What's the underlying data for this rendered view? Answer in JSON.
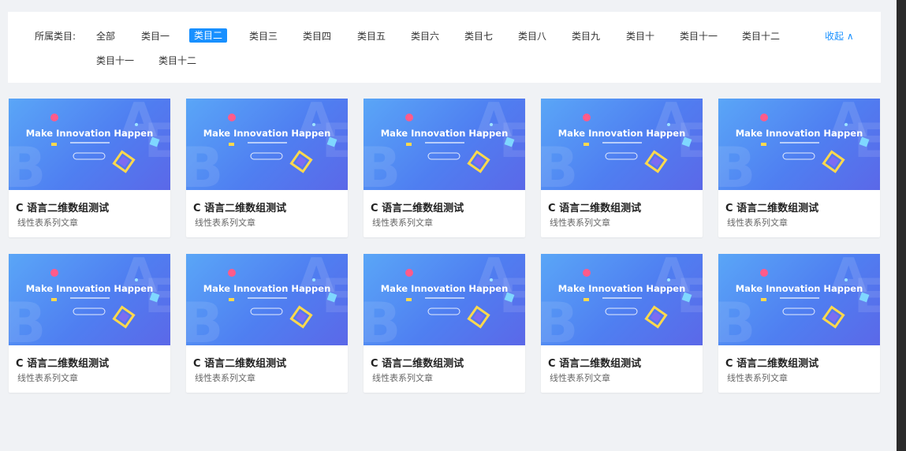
{
  "filter": {
    "label": "所属类目:",
    "categories": [
      "全部",
      "类目一",
      "类目二",
      "类目三",
      "类目四",
      "类目五",
      "类目六",
      "类目七",
      "类目八",
      "类目九",
      "类目十",
      "类目十一",
      "类目十二",
      "类目十一",
      "类目十二"
    ],
    "active_index": 2,
    "collapse_label": "收起 ∧"
  },
  "banner": {
    "headline": "Make Innovation Happen",
    "colors": {
      "from": "#5aa6f7",
      "to": "#5b68e8"
    }
  },
  "cards": [
    {
      "title": "C 语言二维数组测试",
      "subtitle": "线性表系列文章"
    },
    {
      "title": "C 语言二维数组测试",
      "subtitle": "线性表系列文章"
    },
    {
      "title": "C 语言二维数组测试",
      "subtitle": "线性表系列文章"
    },
    {
      "title": "C 语言二维数组测试",
      "subtitle": "线性表系列文章"
    },
    {
      "title": "C 语言二维数组测试",
      "subtitle": "线性表系列文章"
    },
    {
      "title": "C 语言二维数组测试",
      "subtitle": "线性表系列文章"
    },
    {
      "title": "C 语言二维数组测试",
      "subtitle": "线性表系列文章"
    },
    {
      "title": "C 语言二维数组测试",
      "subtitle": "线性表系列文章"
    },
    {
      "title": "C 语言二维数组测试",
      "subtitle": "线性表系列文章"
    },
    {
      "title": "C 语言二维数组测试",
      "subtitle": "线性表系列文章"
    }
  ],
  "colors": {
    "accent": "#1890ff",
    "page_bg": "#f0f2f5"
  }
}
